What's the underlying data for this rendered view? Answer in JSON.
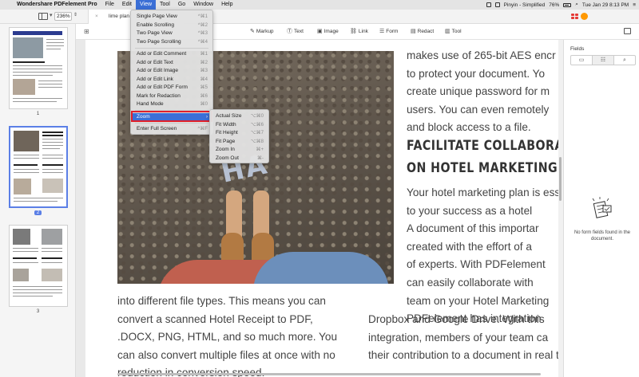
{
  "menubar": {
    "apple": "",
    "items": [
      "Wondershare PDFelement Pro",
      "File",
      "Edit",
      "View",
      "Tool",
      "Go",
      "Window",
      "Help"
    ],
    "status": {
      "input": "Pinyin - Simplified",
      "battery": "76%",
      "clock": "Tue Jan 29  8:13 PM"
    }
  },
  "titlebar": {
    "zoom": "236%",
    "tab_title": "lime plan",
    "tab_close": "×"
  },
  "toolbar": {
    "markup": "Markup",
    "text": "Text",
    "image": "Image",
    "link": "Link",
    "form": "Form",
    "redact": "Redact",
    "tool": "Tool"
  },
  "sidebar": {
    "pages": [
      "1",
      "2",
      "3"
    ]
  },
  "view_menu": {
    "items": [
      {
        "label": "Single Page View",
        "shortcut": "^⌘1"
      },
      {
        "label": "Enable Scrolling",
        "shortcut": "^⌘2"
      },
      {
        "label": "Two Page View",
        "shortcut": "^⌘3"
      },
      {
        "label": "Two Page Scrolling",
        "shortcut": "^⌘4"
      },
      {
        "label": "Add or Edit Comment",
        "shortcut": "⌘1"
      },
      {
        "label": "Add or Edit Text",
        "shortcut": "⌘2"
      },
      {
        "label": "Add or Edit Image",
        "shortcut": "⌘3"
      },
      {
        "label": "Add or Edit Link",
        "shortcut": "⌘4"
      },
      {
        "label": "Add or Edit PDF Form",
        "shortcut": "⌘5"
      },
      {
        "label": "Mark for Redaction",
        "shortcut": "⌘6"
      },
      {
        "label": "Hand Mode",
        "shortcut": "⌘0"
      },
      {
        "label": "Zoom",
        "shortcut": "›"
      },
      {
        "label": "Enter Full Screen",
        "shortcut": "^⌘F"
      }
    ]
  },
  "zoom_submenu": {
    "items": [
      {
        "label": "Actual Size",
        "shortcut": "⌥⌘0"
      },
      {
        "label": "Fit Width",
        "shortcut": "⌥⌘6"
      },
      {
        "label": "Fit Height",
        "shortcut": "⌥⌘7"
      },
      {
        "label": "Fit Page",
        "shortcut": "⌥⌘8"
      },
      {
        "label": "Zoom In",
        "shortcut": "⌘+"
      },
      {
        "label": "Zoom Out",
        "shortcut": "⌘-"
      }
    ]
  },
  "document": {
    "left_column": [
      "into different file types. This means you can",
      "convert a scanned Hotel Receipt to PDF,",
      ".DOCX, PNG, HTML, and so much more. You",
      "can also convert multiple files at once with no",
      "reduction in conversion speed."
    ],
    "right_top": [
      "makes use of 265-bit AES encr",
      "to protect your document. Yo",
      "create unique password for m",
      "users. You can even remotely",
      "and block access to a file."
    ],
    "heading": [
      "FACILITATE    COLLABORA",
      "ON HOTEL MARKETING PL"
    ],
    "right_body": [
      "Your hotel marketing plan is ess",
      "to your success as a hotel",
      "A document of this importar",
      "created with the effort of a",
      "of experts. With PDFelement",
      "can easily collaborate with",
      "team on your Hotel Marketing",
      "PDFelement has integration"
    ],
    "wide_body": [
      "Dropbox and Google Drive. With this",
      "integration, members of your team ca",
      "their contribution to a document in real t"
    ],
    "photo_overlay_text": "HA"
  },
  "fields_panel": {
    "title": "Fields",
    "empty_message": "No form fields found in the document."
  }
}
